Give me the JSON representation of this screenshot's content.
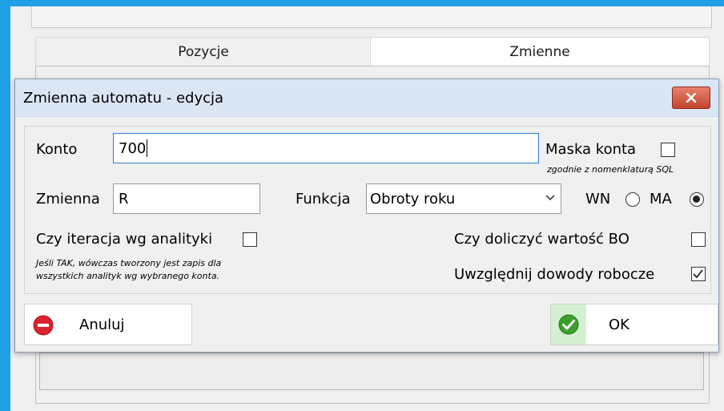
{
  "tabs": {
    "pozycje": "Pozycje",
    "zmienne": "Zmienne"
  },
  "dialog": {
    "title": "Zmienna automatu - edycja",
    "konto_label": "Konto",
    "konto_value": "700",
    "maska_label": "Maska konta",
    "maska_note": "zgodnie z nomenklaturą SQL",
    "maska_checked": false,
    "zmienna_label": "Zmienna",
    "zmienna_value": "R",
    "funkcja_label": "Funkcja",
    "funkcja_value": "Obroty roku",
    "wn_label": "WN",
    "ma_label": "MA",
    "selected_side": "MA",
    "iteracja_label": "Czy iteracja wg analityki",
    "iteracja_checked": false,
    "iteracja_note_line1": "Jeśli TAK, wówczas tworzony jest zapis dla",
    "iteracja_note_line2": "wszystkich analityk wg wybranego konta.",
    "bo_label": "Czy doliczyć wartość BO",
    "bo_checked": false,
    "robocze_label": "Uwzględnij dowody robocze",
    "robocze_checked": true,
    "cancel_label": "Anuluj",
    "ok_label": "OK"
  },
  "colors": {
    "accent": "#1e9fe6",
    "close": "#c2452f",
    "ok_icon": "#3aa02a",
    "cancel_icon": "#d9242f"
  }
}
